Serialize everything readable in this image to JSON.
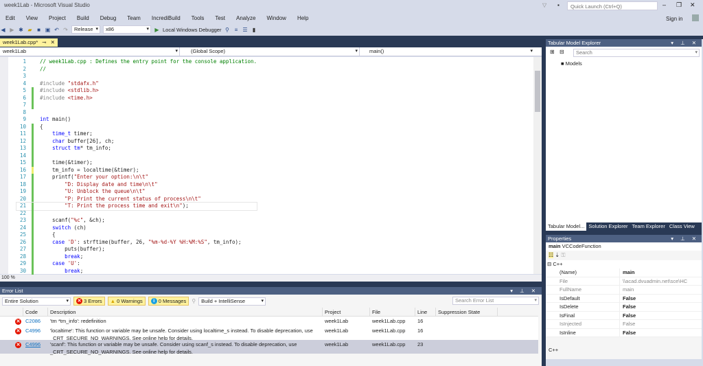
{
  "window": {
    "title": "week1Lab - Microsoft Visual Studio",
    "quick_launch": "Quick Launch (Ctrl+Q)",
    "sign_in": "Sign in"
  },
  "menu": [
    "Edit",
    "View",
    "Project",
    "Build",
    "Debug",
    "Team",
    "IncrediBuild",
    "Tools",
    "Test",
    "Analyze",
    "Window",
    "Help"
  ],
  "toolbar": {
    "config": "Release",
    "platform": "x86",
    "debugger": "Local Windows Debugger"
  },
  "editor": {
    "tab": "week1Lab.cpp*",
    "project_dd": "week1Lab",
    "scope_dd": "(Global Scope)",
    "member_dd": "main()",
    "zoom": "100 %",
    "lines": [
      [
        [
          "c",
          "// week1Lab.cpp : Defines the entry point for the console application."
        ]
      ],
      [
        [
          "c",
          "//"
        ]
      ],
      [],
      [
        [
          "pp",
          "#include "
        ],
        [
          "s",
          "\"stdafx.h\""
        ]
      ],
      [
        [
          "pp",
          "#include "
        ],
        [
          "s",
          "<stdlib.h>"
        ]
      ],
      [
        [
          "pp",
          "#include "
        ],
        [
          "s",
          "<time.h>"
        ]
      ],
      [],
      [],
      [
        [
          "kw",
          "int"
        ],
        [
          "t",
          " main()"
        ]
      ],
      [
        [
          "t",
          "{"
        ]
      ],
      [
        [
          "t",
          "    "
        ],
        [
          "kw",
          "time_t"
        ],
        [
          "t",
          " timer;"
        ]
      ],
      [
        [
          "t",
          "    "
        ],
        [
          "kw",
          "char"
        ],
        [
          "t",
          " buffer[26], ch;"
        ]
      ],
      [
        [
          "t",
          "    "
        ],
        [
          "kw",
          "struct"
        ],
        [
          "t",
          " "
        ],
        [
          "kw",
          "tm"
        ],
        [
          "t",
          "* tm_info;"
        ]
      ],
      [],
      [
        [
          "t",
          "    time(&timer);"
        ]
      ],
      [
        [
          "t",
          "    tm_info = localtime(&timer);"
        ]
      ],
      [
        [
          "t",
          "    printf("
        ],
        [
          "s",
          "\"Enter your option:\\n\\t\""
        ]
      ],
      [
        [
          "t",
          "        "
        ],
        [
          "s",
          "\"D: Display date and time\\n\\t\""
        ]
      ],
      [
        [
          "t",
          "        "
        ],
        [
          "s",
          "\"U: Unblock the queue\\n\\t\""
        ]
      ],
      [
        [
          "t",
          "        "
        ],
        [
          "s",
          "\"P: Print the current status of process\\n\\t\""
        ]
      ],
      [
        [
          "t",
          "        "
        ],
        [
          "s",
          "\"T: Print the process time and exit\\n\""
        ],
        [
          "t",
          ");"
        ]
      ],
      [],
      [
        [
          "t",
          "    scanf("
        ],
        [
          "s",
          "\"%c\""
        ],
        [
          "t",
          ", &ch);"
        ]
      ],
      [
        [
          "t",
          "    "
        ],
        [
          "kw",
          "switch"
        ],
        [
          "t",
          " (ch)"
        ]
      ],
      [
        [
          "t",
          "    {"
        ]
      ],
      [
        [
          "t",
          "    "
        ],
        [
          "kw",
          "case"
        ],
        [
          "t",
          " "
        ],
        [
          "s",
          "'D'"
        ],
        [
          "t",
          ": strftime(buffer, 26, "
        ],
        [
          "s",
          "\"%m-%d-%Y %H:%M:%S\""
        ],
        [
          "t",
          ", tm_info);"
        ]
      ],
      [
        [
          "t",
          "        puts(buffer);"
        ]
      ],
      [
        [
          "t",
          "        "
        ],
        [
          "kw",
          "break"
        ],
        [
          "t",
          ";"
        ]
      ],
      [
        [
          "t",
          "    "
        ],
        [
          "kw",
          "case"
        ],
        [
          "t",
          " "
        ],
        [
          "s",
          "'U'"
        ],
        [
          "t",
          ":"
        ]
      ],
      [
        [
          "t",
          "        "
        ],
        [
          "kw",
          "break"
        ],
        [
          "t",
          ";"
        ]
      ]
    ]
  },
  "error_list": {
    "title": "Error List",
    "scope": "Entire Solution",
    "errors": "3 Errors",
    "warnings": "0 Warnings",
    "messages": "0 Messages",
    "source": "Build + IntelliSense",
    "search": "Search Error List",
    "columns": [
      "Code",
      "Description",
      "Project",
      "File",
      "Line",
      "Suppression State"
    ],
    "rows": [
      {
        "code": "C2086",
        "desc": "'tm *tm_info': redefinition",
        "desc2": "",
        "project": "week1Lab",
        "file": "week1Lab.cpp",
        "line": "16"
      },
      {
        "code": "C4996",
        "desc": "'localtime': This function or variable may be unsafe. Consider using localtime_s instead. To disable deprecation, use",
        "desc2": "_CRT_SECURE_NO_WARNINGS. See online help for details.",
        "project": "week1Lab",
        "file": "week1Lab.cpp",
        "line": "16"
      },
      {
        "code": "C4996",
        "desc": "'scanf': This function or variable may be unsafe. Consider using scanf_s instead. To disable deprecation, use",
        "desc2": "_CRT_SECURE_NO_WARNINGS. See online help for details.",
        "project": "week1Lab",
        "file": "week1Lab.cpp",
        "line": "23"
      }
    ]
  },
  "tabular": {
    "title": "Tabular Model Explorer",
    "search": "Search",
    "node": "Models"
  },
  "right_tabs": [
    "Tabular Model...",
    "Solution Explorer",
    "Team Explorer",
    "Class View"
  ],
  "properties": {
    "title": "Properties",
    "object_name": "main",
    "object_type": "VCCodeFunction",
    "category": "C++",
    "description": "C++",
    "rows": [
      {
        "k": "(Name)",
        "v": "main"
      },
      {
        "k": "File",
        "v": "\\\\acad.dvuadmin.net\\sce\\HC"
      },
      {
        "k": "FullName",
        "v": "main"
      },
      {
        "k": "IsDefault",
        "v": "False"
      },
      {
        "k": "IsDelete",
        "v": "False"
      },
      {
        "k": "IsFinal",
        "v": "False"
      },
      {
        "k": "IsInjected",
        "v": "False"
      },
      {
        "k": "IsInline",
        "v": "False"
      }
    ]
  }
}
